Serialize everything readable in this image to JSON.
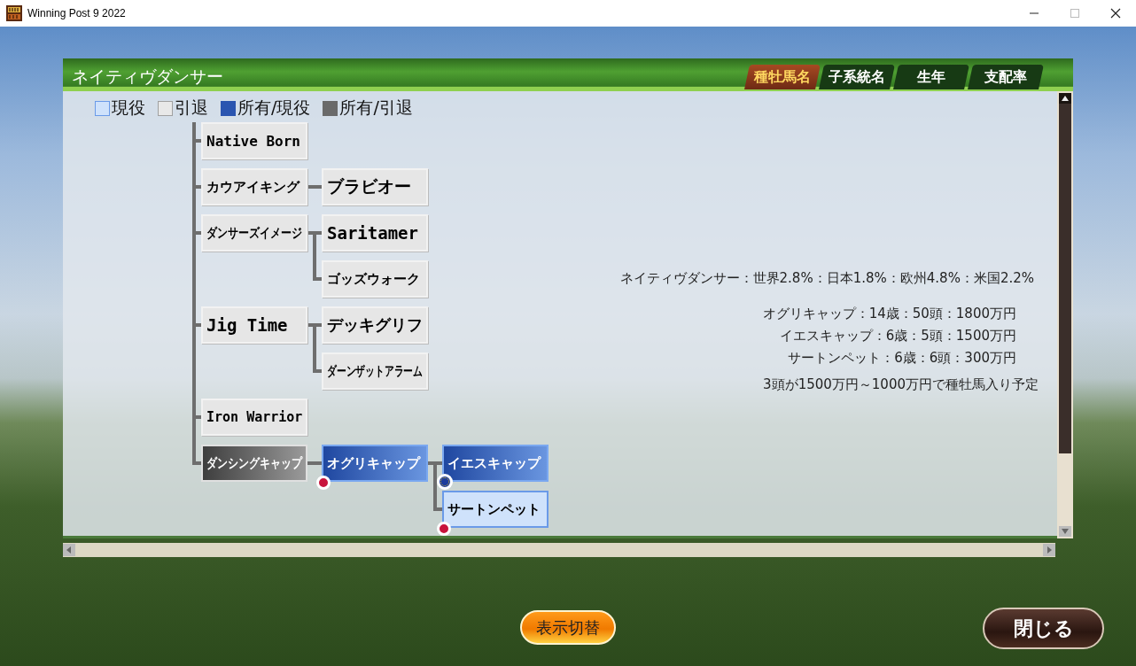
{
  "window": {
    "title": "Winning Post 9 2022"
  },
  "panel": {
    "title": "ネイティヴダンサー"
  },
  "tabs": [
    {
      "label": "種牡馬名",
      "selected": true
    },
    {
      "label": "子系統名",
      "selected": false
    },
    {
      "label": "生年",
      "selected": false
    },
    {
      "label": "支配率",
      "selected": false
    }
  ],
  "legend": [
    {
      "kind": "active",
      "label": "現役"
    },
    {
      "kind": "retired",
      "label": "引退"
    },
    {
      "kind": "owned_active",
      "label": "所有/現役"
    },
    {
      "kind": "owned_retired",
      "label": "所有/引退"
    }
  ],
  "tree": [
    {
      "name": "Native Born",
      "kind": "retired"
    },
    {
      "name": "カウアイキング",
      "kind": "retired",
      "children": [
        {
          "name": "ブラビオー",
          "kind": "retired"
        }
      ]
    },
    {
      "name": "ダンサーズイメージ",
      "kind": "retired",
      "children": [
        {
          "name": "Saritamer",
          "kind": "retired"
        },
        {
          "name": "ゴッズウォーク",
          "kind": "retired"
        }
      ]
    },
    {
      "name": "Jig Time",
      "kind": "retired",
      "children": [
        {
          "name": "デッキグリフ",
          "kind": "retired"
        },
        {
          "name": "ダーンザットアラーム",
          "kind": "retired"
        }
      ]
    },
    {
      "name": "Iron Warrior",
      "kind": "retired"
    },
    {
      "name": "ダンシングキャップ",
      "kind": "owned_retired",
      "children": [
        {
          "name": "オグリキャップ",
          "kind": "owned_active",
          "badge": {
            "kind": "dot",
            "color": "#c8143c"
          },
          "children": [
            {
              "name": "イエスキャップ",
              "kind": "owned_active",
              "badge": {
                "kind": "stars",
                "color": "#1c3c9c"
              }
            },
            {
              "name": "サートンペット",
              "kind": "active",
              "badge": {
                "kind": "dot",
                "color": "#c8143c"
              }
            }
          ]
        }
      ]
    }
  ],
  "stats": {
    "share": "ネイティヴダンサー：世界2.8%：日本1.8%：欧州4.8%：米国2.2%",
    "sires": [
      "オグリキャップ：14歳：50頭：1800万円",
      "イエスキャップ：6歳：5頭：1500万円",
      "サートンペット：6歳：6頭：300万円"
    ],
    "forecast": "3頭が1500万円～1000万円で種牡馬入り予定"
  },
  "buttons": {
    "toggle": "表示切替",
    "close": "閉じる"
  }
}
